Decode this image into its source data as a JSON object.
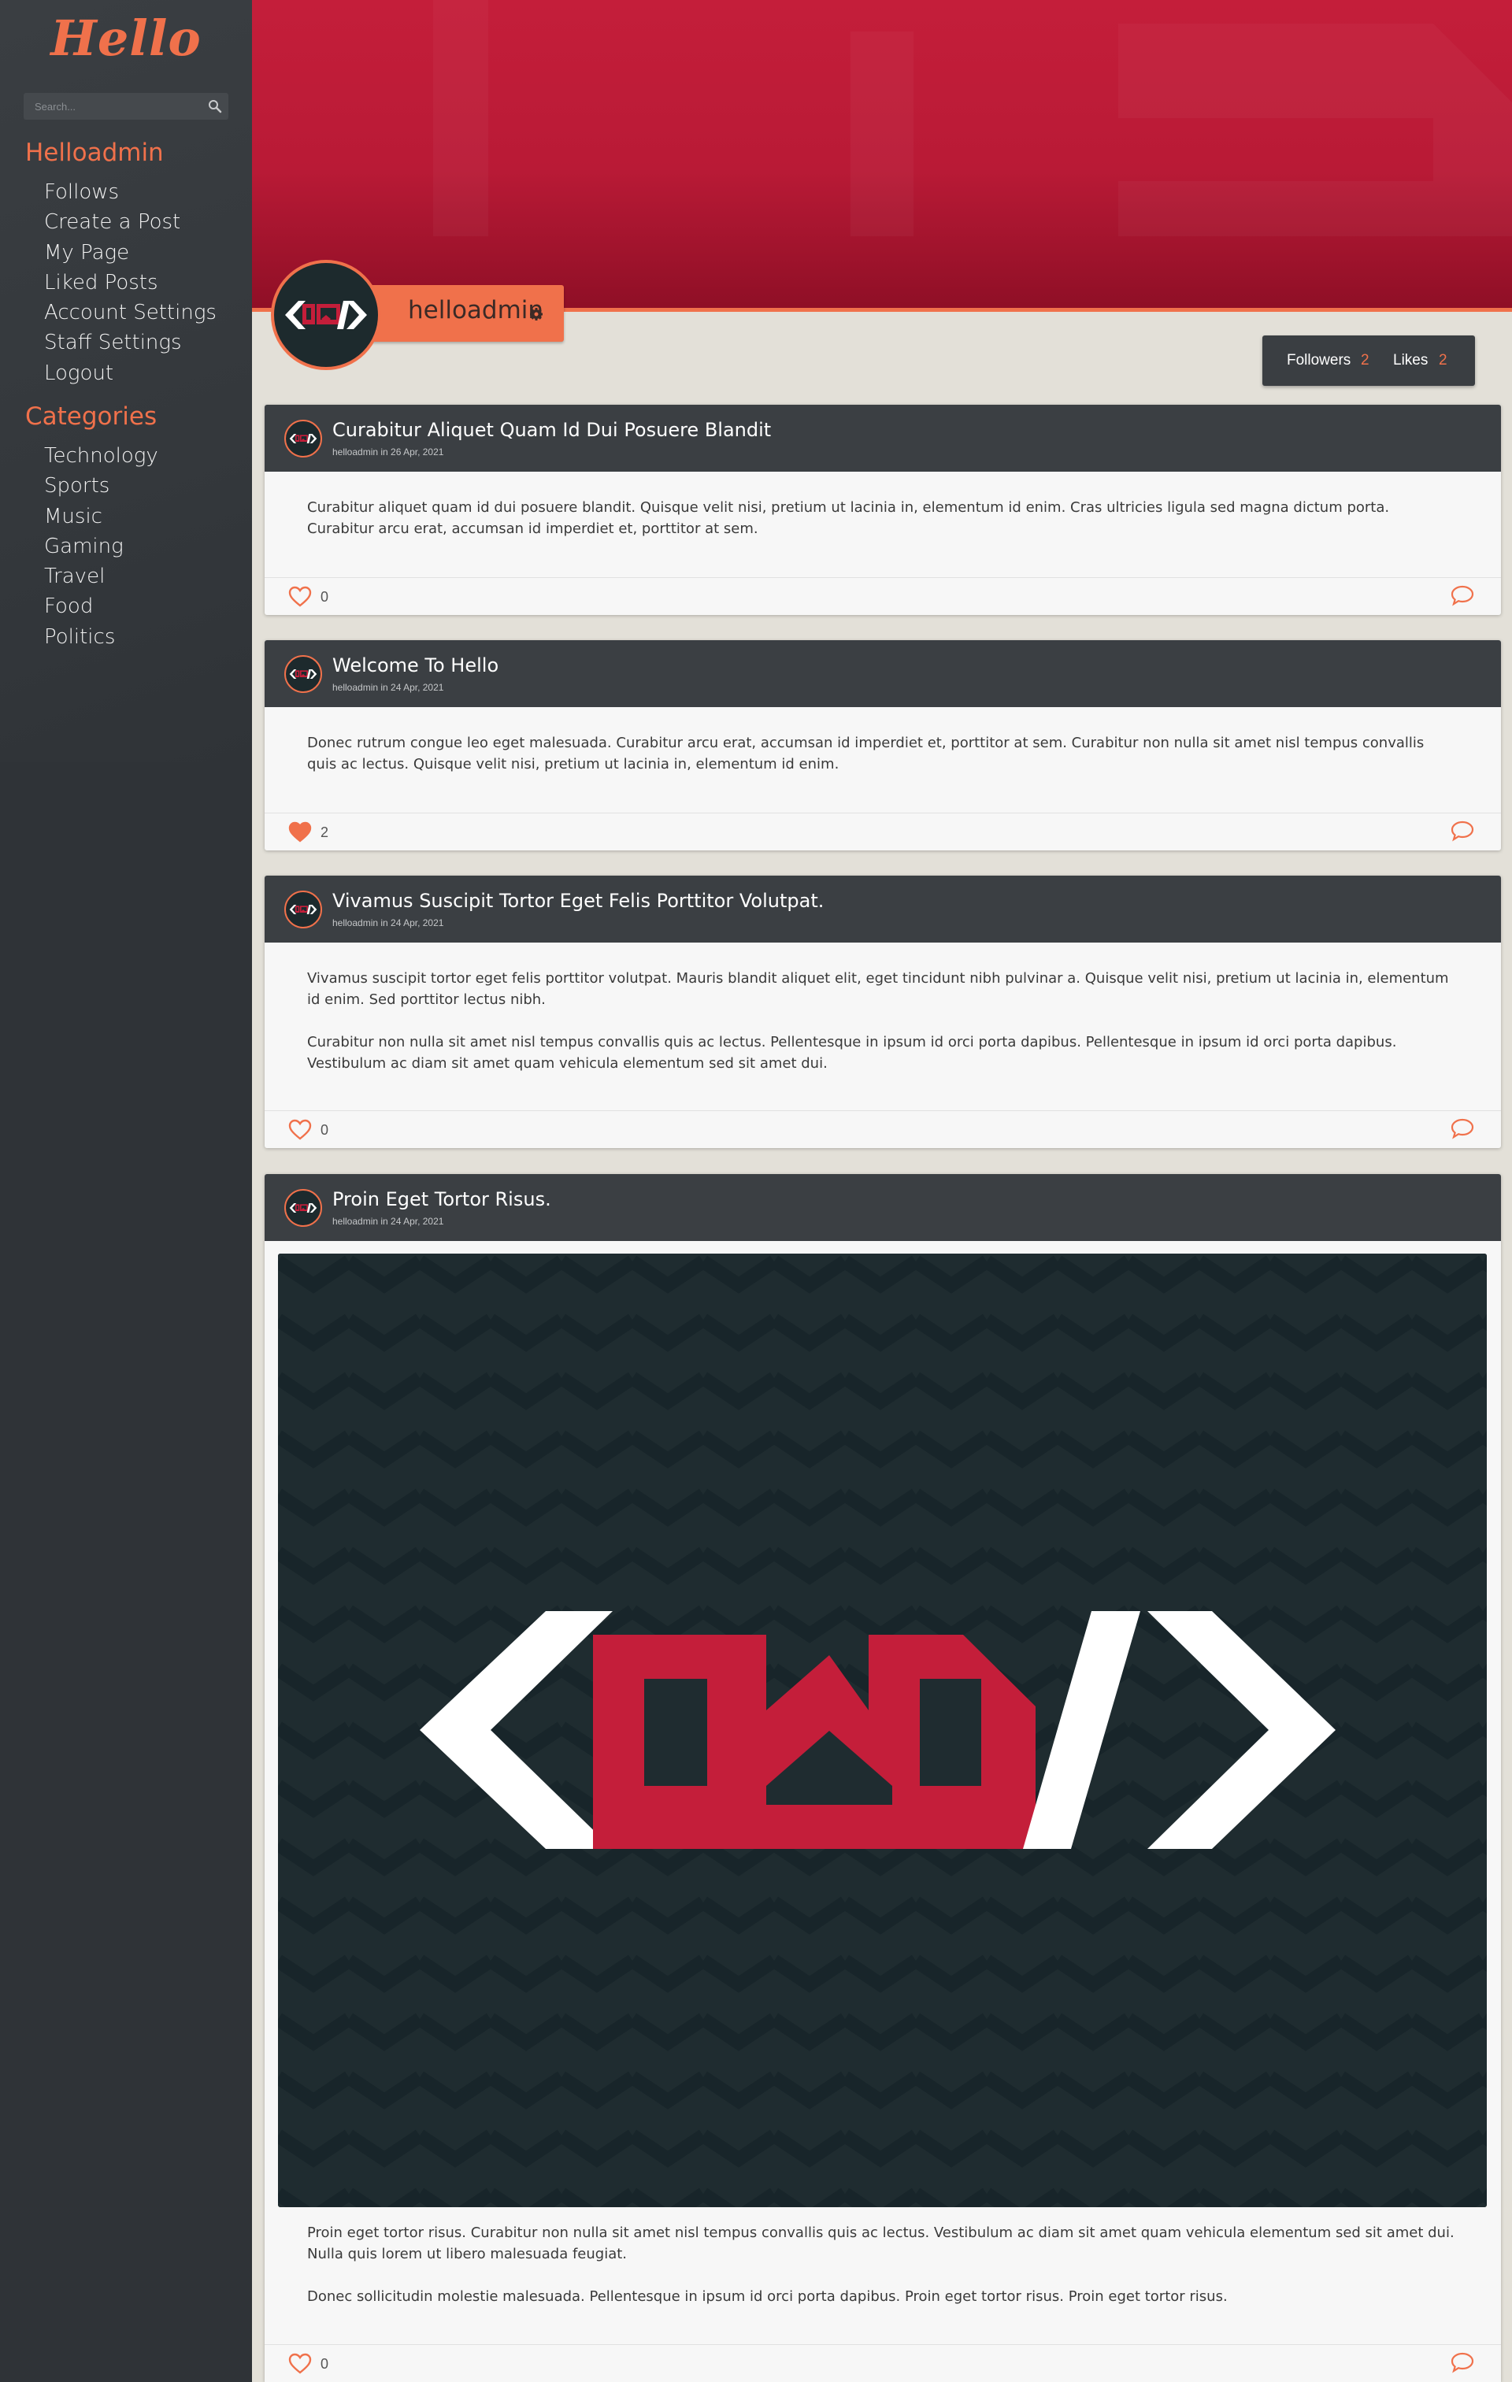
{
  "brand": {
    "logo_text": "Hello",
    "accent": "#f0714b",
    "banner_color": "#c41e3a",
    "dark": "#3b3f43"
  },
  "search": {
    "placeholder": "Search...",
    "icon": "search-icon"
  },
  "user_menu": {
    "heading": "Helloadmin",
    "items": [
      {
        "label": "Follows"
      },
      {
        "label": "Create a Post"
      },
      {
        "label": "My Page"
      },
      {
        "label": "Liked Posts"
      },
      {
        "label": "Account Settings"
      },
      {
        "label": "Staff Settings"
      },
      {
        "label": "Logout"
      }
    ]
  },
  "categories": {
    "heading": "Categories",
    "items": [
      {
        "label": "Technology"
      },
      {
        "label": "Sports"
      },
      {
        "label": "Music"
      },
      {
        "label": "Gaming"
      },
      {
        "label": "Travel"
      },
      {
        "label": "Food"
      },
      {
        "label": "Politics"
      }
    ]
  },
  "profile": {
    "username": "helloadmin",
    "settings_icon": "gear-icon",
    "followers_label": "Followers",
    "followers_count": "2",
    "likes_label": "Likes",
    "likes_count": "2"
  },
  "posts": [
    {
      "title": "Curabitur Aliquet Quam Id Dui Posuere Blandit",
      "meta": "helloadmin in 26 Apr, 2021",
      "paragraphs": [
        "Curabitur aliquet quam id dui posuere blandit. Quisque velit nisi, pretium ut lacinia in, elementum id enim. Cras ultricies ligula sed magna dictum porta. Curabitur arcu erat, accumsan id imperdiet et, porttitor at sem."
      ],
      "likes": "0",
      "liked": false
    },
    {
      "title": "Welcome To Hello",
      "meta": "helloadmin in 24 Apr, 2021",
      "paragraphs": [
        "Donec rutrum congue leo eget malesuada. Curabitur arcu erat, accumsan id imperdiet et, porttitor at sem. Curabitur non nulla sit amet nisl tempus convallis quis ac lectus. Quisque velit nisi, pretium ut lacinia in, elementum id enim."
      ],
      "likes": "2",
      "liked": true
    },
    {
      "title": "Vivamus Suscipit Tortor Eget Felis Porttitor Volutpat.",
      "meta": "helloadmin in 24 Apr, 2021",
      "paragraphs": [
        "Vivamus suscipit tortor eget felis porttitor volutpat. Mauris blandit aliquet elit, eget tincidunt nibh pulvinar a. Quisque velit nisi, pretium ut lacinia in, elementum id enim. Sed porttitor lectus nibh.",
        "Curabitur non nulla sit amet nisl tempus convallis quis ac lectus. Pellentesque in ipsum id orci porta dapibus. Pellentesque in ipsum id orci porta dapibus. Vestibulum ac diam sit amet quam vehicula elementum sed sit amet dui."
      ],
      "likes": "0",
      "liked": false
    },
    {
      "title": "Proin Eget Tortor Risus.",
      "meta": "helloadmin in 24 Apr, 2021",
      "paragraphs": [
        "Proin eget tortor risus. Curabitur non nulla sit amet nisl tempus convallis quis ac lectus. Vestibulum ac diam sit amet quam vehicula elementum sed sit amet dui. Nulla quis lorem ut libero malesuada feugiat.",
        "Donec sollicitudin molestie malesuada. Pellentesque in ipsum id orci porta dapibus. Proin eget tortor risus. Proin eget tortor risus."
      ],
      "likes": "0",
      "liked": false,
      "has_image": true
    }
  ]
}
